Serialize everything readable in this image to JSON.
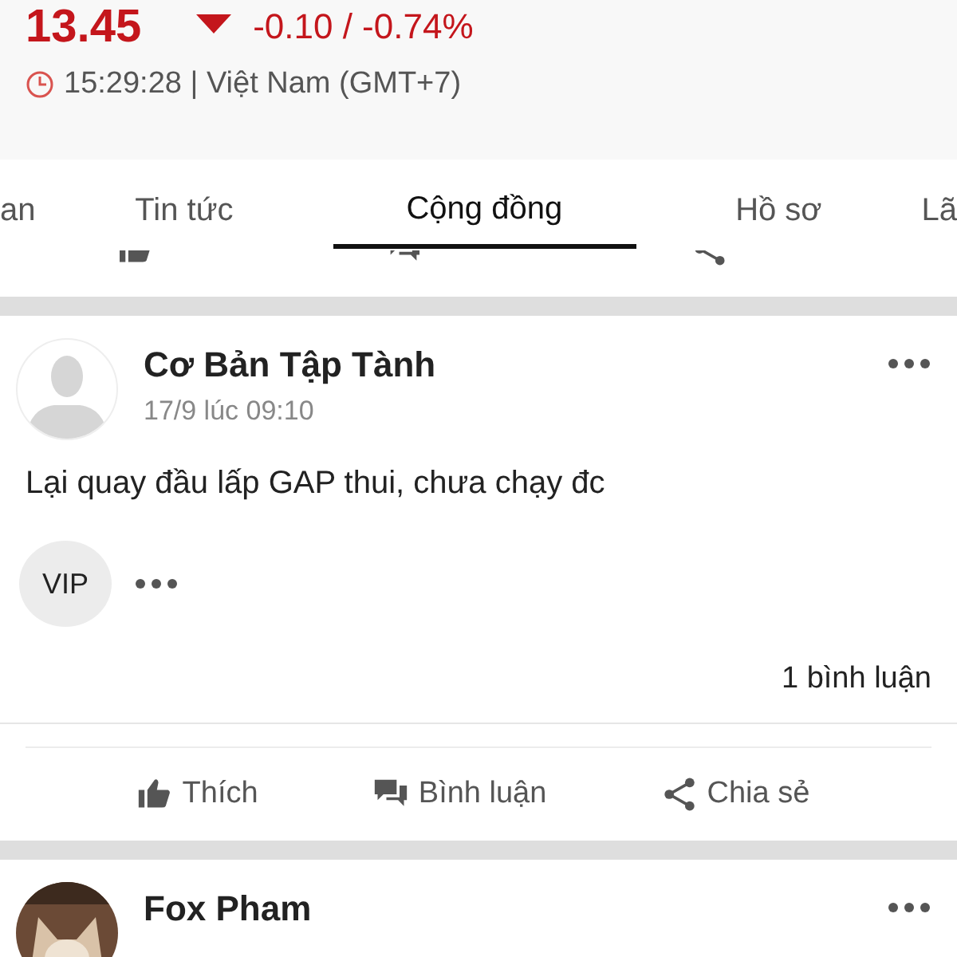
{
  "quote": {
    "price": "13.45",
    "kind": "down",
    "change": "-0.10 / -0.74%",
    "time": "15:29:28 | Việt Nam (GMT+7)"
  },
  "tabs": [
    {
      "label": "an",
      "selected": false
    },
    {
      "label": "Tin tức",
      "selected": false
    },
    {
      "label": "Cộng đồng",
      "selected": true
    },
    {
      "label": "Hồ sơ",
      "selected": false
    },
    {
      "label": "Lã",
      "selected": false
    }
  ],
  "previous_post_actions": [
    {
      "kind": "like"
    },
    {
      "kind": "comment"
    },
    {
      "kind": "share"
    }
  ],
  "posts": [
    {
      "author": "Cơ Bản Tập Tành",
      "avatar": {
        "kind": "placeholder"
      },
      "time": "17/9 lúc 09:10",
      "body": "Lại quay đầu lấp GAP thui, chưa chạy đc",
      "badge": "VIP",
      "comments": "1 bình luận",
      "actions": [
        {
          "kind": "like",
          "label": "Thích"
        },
        {
          "kind": "comment",
          "label": "Bình luận"
        },
        {
          "kind": "share",
          "label": "Chia sẻ"
        }
      ]
    },
    {
      "author": "Fox Pham"
    }
  ]
}
